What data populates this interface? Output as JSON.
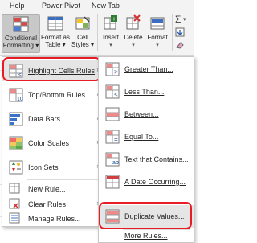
{
  "ribbon": {
    "tabs": [
      "Help",
      "Power Pivot",
      "New Tab"
    ],
    "buttons": {
      "conditional_formatting": {
        "line1": "Conditional",
        "line2": "Formatting ▾"
      },
      "format_as_table": {
        "line1": "Format as",
        "line2": "Table ▾"
      },
      "cell_styles": {
        "line1": "Cell",
        "line2": "Styles ▾"
      },
      "insert": "Insert",
      "delete": "Delete",
      "format": "Format"
    }
  },
  "cf_menu": {
    "items": [
      {
        "label": "Highlight Cells Rules",
        "submenu": true,
        "highlighted": true
      },
      {
        "label": "Top/Bottom Rules",
        "submenu": true
      },
      {
        "label": "Data Bars",
        "submenu": true
      },
      {
        "label": "Color Scales",
        "submenu": true
      },
      {
        "label": "Icon Sets",
        "submenu": true
      },
      {
        "label": "New Rule..."
      },
      {
        "label": "Clear Rules",
        "submenu": true
      },
      {
        "label": "Manage Rules..."
      }
    ]
  },
  "highlight_submenu": {
    "items": [
      {
        "label": "Greater Than..."
      },
      {
        "label": "Less Than..."
      },
      {
        "label": "Between..."
      },
      {
        "label": "Equal To..."
      },
      {
        "label": "Text that Contains..."
      },
      {
        "label": "A Date Occurring..."
      },
      {
        "label": "Duplicate Values...",
        "highlighted": true
      },
      {
        "label": "More Rules..."
      }
    ]
  },
  "colors": {
    "highlight_outline": "#e81c24",
    "menu_hover": "#e5e5e5",
    "ribbon_bg": "#f3f3f3"
  }
}
